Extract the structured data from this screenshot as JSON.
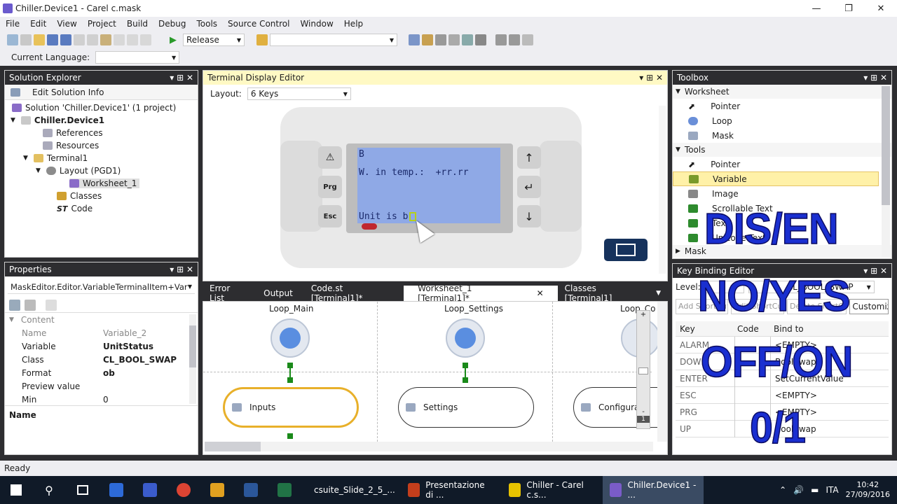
{
  "window": {
    "title": "Chiller.Device1 - Carel c.mask"
  },
  "menu": [
    "File",
    "Edit",
    "View",
    "Project",
    "Build",
    "Debug",
    "Tools",
    "Source Control",
    "Window",
    "Help"
  ],
  "toolbar": {
    "config": "Release",
    "search": ""
  },
  "toolbar2": {
    "lang_label": "Current Language:",
    "lang_value": ""
  },
  "solution": {
    "header": "Solution Explorer",
    "edit_info": "Edit Solution Info",
    "items": [
      "Solution 'Chiller.Device1' (1 project)",
      "Chiller.Device1",
      "References",
      "Resources",
      "Terminal1",
      "Layout (PGD1)",
      "Worksheet_1",
      "Classes",
      "Code"
    ]
  },
  "properties": {
    "header": "Properties",
    "object": "MaskEditor.Editor.VariableTerminalItem+Variabl",
    "category": "Content",
    "rows": [
      {
        "k": "Name",
        "v": "Variable_2"
      },
      {
        "k": "Variable",
        "v": "UnitStatus"
      },
      {
        "k": "Class",
        "v": "CL_BOOL_SWAP"
      },
      {
        "k": "Format",
        "v": "ob"
      },
      {
        "k": "Preview value",
        "v": ""
      },
      {
        "k": "Min",
        "v": "0"
      }
    ],
    "desc_title": "Name"
  },
  "terminal": {
    "header": "Terminal Display Editor",
    "layout_label": "Layout:",
    "layout_value": "6 Keys",
    "lcd": {
      "line1": "B",
      "line2": "W. in temp.:  +rr.rr",
      "line4": "Unit is b"
    },
    "keys": {
      "prg": "Prg",
      "esc": "Esc"
    }
  },
  "doctabs": [
    "Error List",
    "Output",
    "Code.st [Terminal1]*",
    "Worksheet_1 [Terminal1]*",
    "Classes [Terminal1]"
  ],
  "worksheet": {
    "loops": [
      "Loop_Main",
      "Loop_Settings",
      "Loop_Conf"
    ],
    "nodes": [
      "Inputs",
      "Settings",
      "Configuratio"
    ],
    "zoom": "1"
  },
  "toolbox": {
    "header": "Toolbox",
    "worksheet_group": "Worksheet",
    "worksheet_items": [
      "Pointer",
      "Loop",
      "Mask"
    ],
    "tools_group": "Tools",
    "tools_items": [
      "Pointer",
      "Variable",
      "Image",
      "Scrollable Text",
      "Text",
      "Unicode Text"
    ],
    "mask_group": "Mask"
  },
  "keybinding": {
    "header": "Key Binding Editor",
    "level_label": "Level:",
    "instance_value": "CL_BOOL_SWAP",
    "buttons": [
      "Add ShortCut",
      "Edit ShortCut",
      "Delete ShortCut",
      "Customiz"
    ],
    "cols": [
      "Key",
      "Code",
      "Bind to"
    ],
    "rows": [
      {
        "key": "ALARM",
        "bind": "<EMPTY>"
      },
      {
        "key": "DOWN",
        "bind": "BoolSwap"
      },
      {
        "key": "ENTER",
        "bind": "SetCurrentValue"
      },
      {
        "key": "ESC",
        "bind": "<EMPTY>"
      },
      {
        "key": "PRG",
        "bind": "<EMPTY>"
      },
      {
        "key": "UP",
        "bind": "BoolSwap"
      }
    ]
  },
  "overlay": [
    "DIS/EN",
    "NO/YES",
    "OFF/ON",
    "0/1"
  ],
  "status": "Ready",
  "taskbar": {
    "apps": [
      "csuite_Slide_2_5_...",
      "Presentazione di ...",
      "Chiller - Carel c.s...",
      "Chiller.Device1 - ..."
    ],
    "lang": "ITA",
    "time": "10:42",
    "date": "27/09/2016"
  }
}
